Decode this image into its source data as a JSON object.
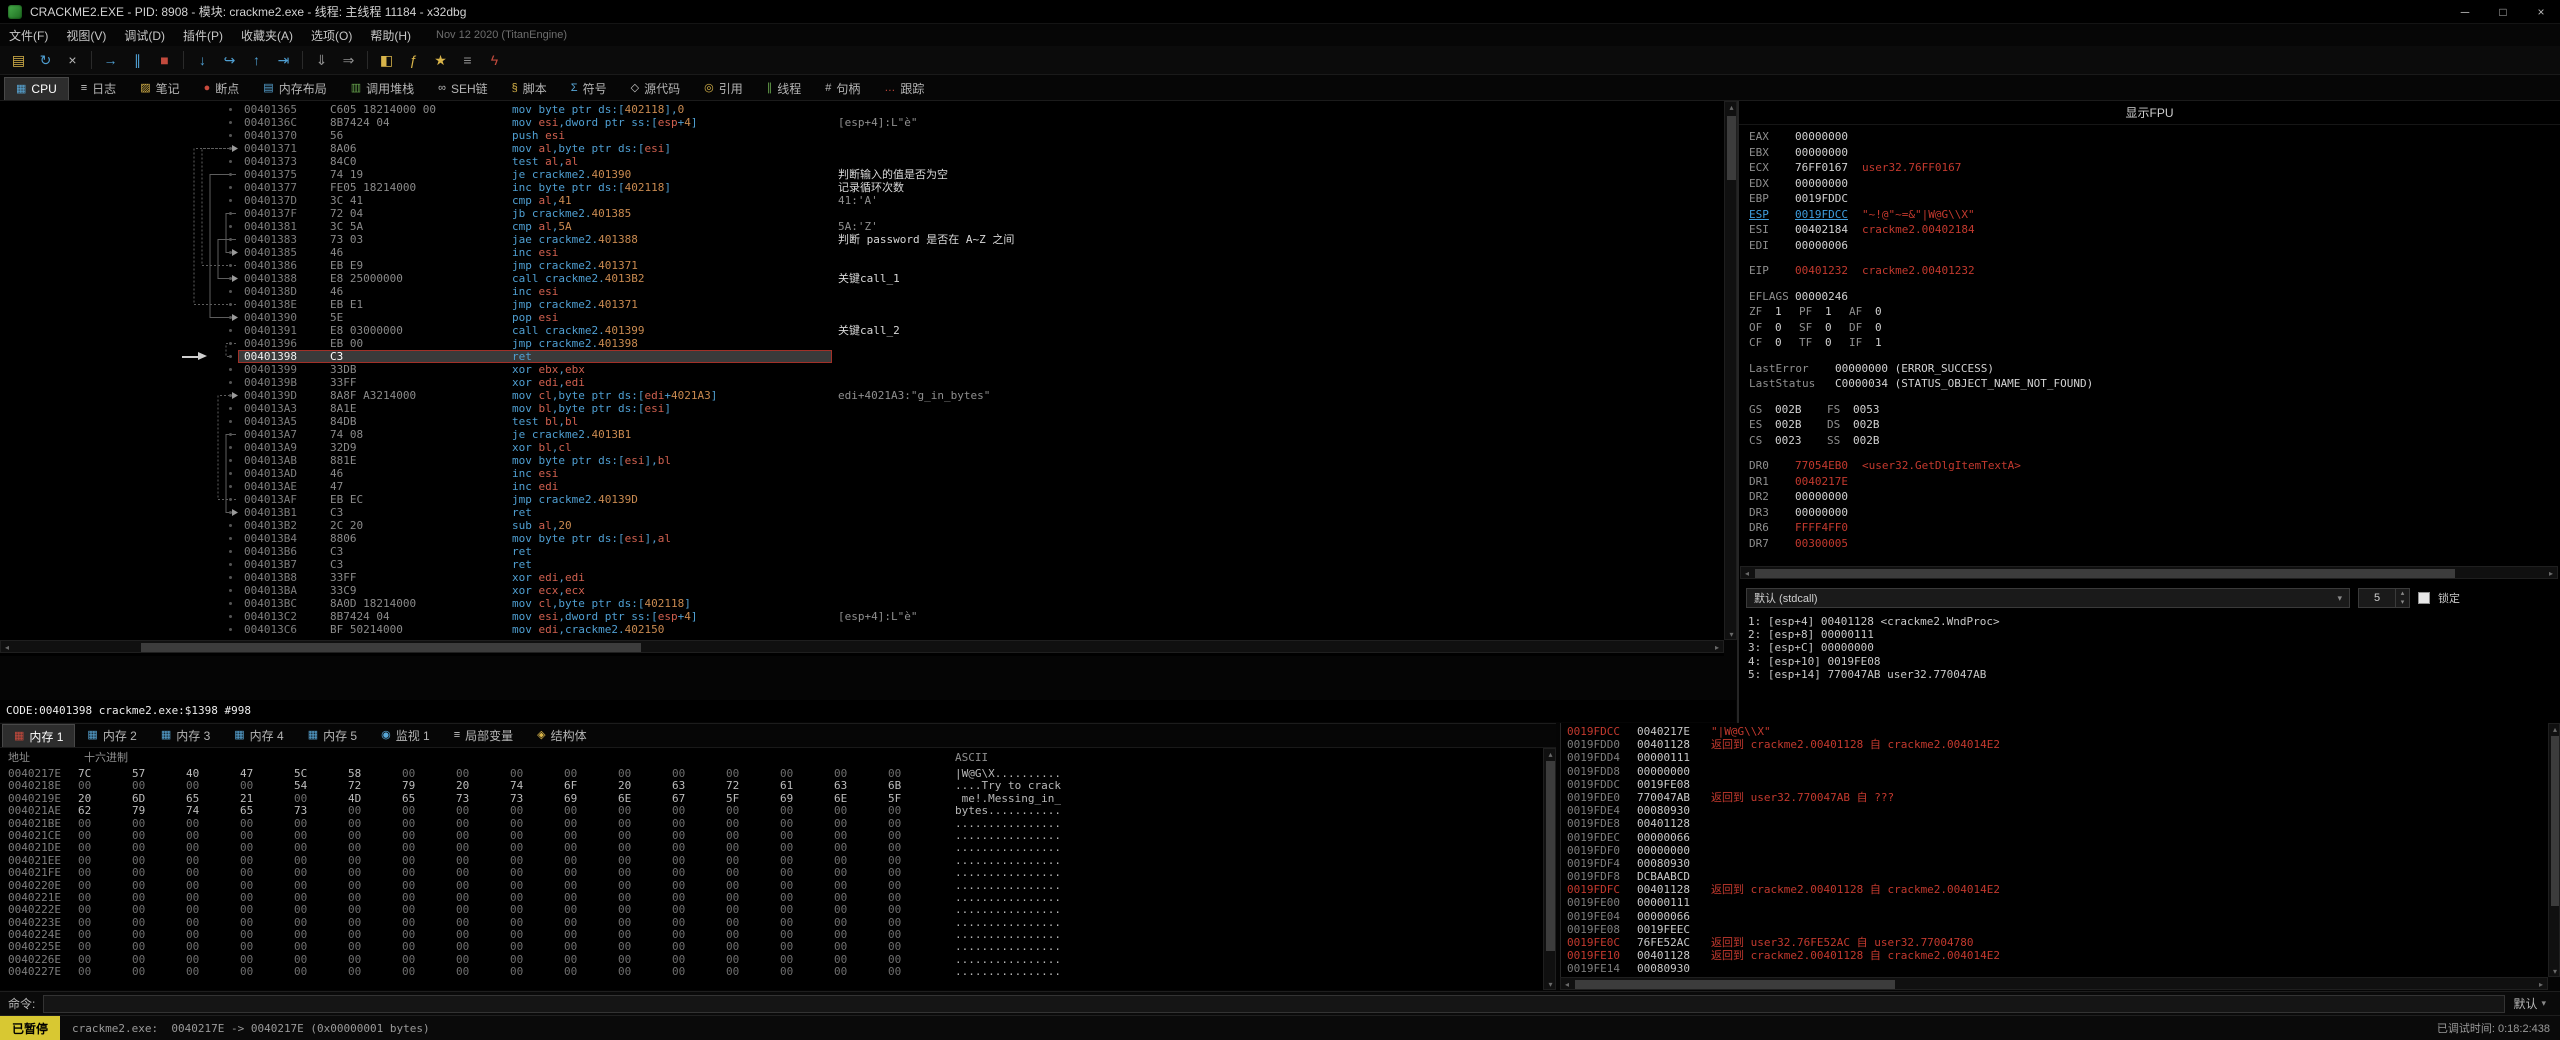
{
  "title_bar": {
    "title": "CRACKME2.EXE - PID: 8908 - 模块: crackme2.exe - 线程: 主线程 11184 - x32dbg",
    "minimize": "─",
    "maximize": "□",
    "close": "×"
  },
  "menu": {
    "items": [
      "文件(F)",
      "视图(V)",
      "调试(D)",
      "插件(P)",
      "收藏夹(A)",
      "选项(O)",
      "帮助(H)"
    ],
    "build_info": "Nov 12 2020 (TitanEngine)"
  },
  "toolbar": [
    {
      "name": "open-file",
      "glyph": "▤",
      "color": "#d8b44a"
    },
    {
      "name": "restart",
      "glyph": "↻",
      "color": "#4f9fd2"
    },
    {
      "name": "close-debuggee",
      "glyph": "×",
      "color": "#b8b8b8"
    },
    {
      "sep": true
    },
    {
      "name": "run",
      "glyph": "→",
      "color": "#4f9fd2"
    },
    {
      "name": "pause",
      "glyph": "∥",
      "color": "#4f9fd2"
    },
    {
      "name": "stop",
      "glyph": "■",
      "color": "#c24a3d"
    },
    {
      "sep": true
    },
    {
      "name": "step-into",
      "glyph": "↓",
      "color": "#4f9fd2"
    },
    {
      "name": "step-over",
      "glyph": "↪",
      "color": "#4f9fd2"
    },
    {
      "name": "step-out",
      "glyph": "↑",
      "color": "#4f9fd2"
    },
    {
      "name": "run-to-user-code",
      "glyph": "⇥",
      "color": "#4f9fd2"
    },
    {
      "sep": true
    },
    {
      "name": "trace-into",
      "glyph": "⇓",
      "color": "#8f8f8f"
    },
    {
      "name": "trace-over",
      "glyph": "⇒",
      "color": "#8f8f8f"
    },
    {
      "sep": true
    },
    {
      "name": "patch",
      "glyph": "◧",
      "color": "#d8b44a"
    },
    {
      "name": "fx-actions",
      "glyph": "ƒ",
      "color": "#d8b44a"
    },
    {
      "name": "favourites",
      "glyph": "★",
      "color": "#d8b44a"
    },
    {
      "name": "preferences",
      "glyph": "≡",
      "color": "#8f8f8f"
    },
    {
      "name": "seh-chain",
      "glyph": "ϟ",
      "color": "#c24a3d"
    }
  ],
  "view_tabs": [
    {
      "name": "cpu",
      "label": "CPU",
      "icon": "▦",
      "color": "#58a6d6",
      "active": true
    },
    {
      "name": "log",
      "label": "日志",
      "icon": "≡",
      "color": "#c8c8c8"
    },
    {
      "name": "notes",
      "label": "笔记",
      "icon": "▨",
      "color": "#d8b44a"
    },
    {
      "name": "breakpoints",
      "label": "断点",
      "icon": "●",
      "color": "#c94a3d"
    },
    {
      "name": "memory-map",
      "label": "内存布局",
      "icon": "▤",
      "color": "#58a6d6"
    },
    {
      "name": "call-stack",
      "label": "调用堆栈",
      "icon": "▥",
      "color": "#6aa84f"
    },
    {
      "name": "seh",
      "label": "SEH链",
      "icon": "∞",
      "color": "#b8b8b8"
    },
    {
      "name": "script",
      "label": "脚本",
      "icon": "§",
      "color": "#d8b44a"
    },
    {
      "name": "symbols",
      "label": "符号",
      "icon": "Σ",
      "color": "#58a6d6"
    },
    {
      "name": "source",
      "label": "源代码",
      "icon": "◇",
      "color": "#c8c8c8"
    },
    {
      "name": "references",
      "label": "引用",
      "icon": "◎",
      "color": "#d8b44a"
    },
    {
      "name": "threads",
      "label": "线程",
      "icon": "∥",
      "color": "#6aa84f"
    },
    {
      "name": "handles",
      "label": "句柄",
      "icon": "#",
      "color": "#b8b8b8"
    },
    {
      "name": "trace",
      "label": "跟踪",
      "icon": "…",
      "color": "#c94a3d"
    }
  ],
  "disasm": {
    "info_line": "CODE:00401398 crackme2.exe:$1398 #998",
    "rows": [
      {
        "a": "00401365",
        "b": "C605 18214000 00",
        "i": "mov byte ptr ds:[402118],0"
      },
      {
        "a": "0040136C",
        "b": "8B7424 04",
        "i": "mov esi,dword ptr ss:[esp+4]",
        "c": "[esp+4]:L\"è\""
      },
      {
        "a": "00401370",
        "b": "56",
        "i": "push esi"
      },
      {
        "a": "00401371",
        "b": "8A06",
        "i": "mov al,byte ptr ds:[esi]"
      },
      {
        "a": "00401373",
        "b": "84C0",
        "i": "test al,al"
      },
      {
        "a": "00401375",
        "b": "74 19",
        "i": "je crackme2.401390",
        "c": "判断输入的值是否为空",
        "u": true
      },
      {
        "a": "00401377",
        "b": "FE05 18214000",
        "i": "inc byte ptr ds:[402118]",
        "c": "记录循环次数",
        "u": true
      },
      {
        "a": "0040137D",
        "b": "3C 41",
        "i": "cmp al,41",
        "c": "41:'A'"
      },
      {
        "a": "0040137F",
        "b": "72 04",
        "i": "jb crackme2.401385"
      },
      {
        "a": "00401381",
        "b": "3C 5A",
        "i": "cmp al,5A",
        "c": "5A:'Z'"
      },
      {
        "a": "00401383",
        "b": "73 03",
        "i": "jae crackme2.401388",
        "c": "判断 password 是否在 A~Z 之间",
        "u": true
      },
      {
        "a": "00401385",
        "b": "46",
        "i": "inc esi"
      },
      {
        "a": "00401386",
        "b": "EB E9",
        "i": "jmp crackme2.401371"
      },
      {
        "a": "00401388",
        "b": "E8 25000000",
        "i": "call crackme2.4013B2",
        "c": "关键call_1",
        "u": true
      },
      {
        "a": "0040138D",
        "b": "46",
        "i": "inc esi"
      },
      {
        "a": "0040138E",
        "b": "EB E1",
        "i": "jmp crackme2.401371"
      },
      {
        "a": "00401390",
        "b": "5E",
        "i": "pop esi"
      },
      {
        "a": "00401391",
        "b": "E8 03000000",
        "i": "call crackme2.401399",
        "c": "关键call_2",
        "u": true
      },
      {
        "a": "00401396",
        "b": "EB 00",
        "i": "jmp crackme2.401398"
      },
      {
        "a": "00401398",
        "b": "C3",
        "i": "ret",
        "sel": true
      },
      {
        "a": "00401399",
        "b": "33DB",
        "i": "xor ebx,ebx"
      },
      {
        "a": "0040139B",
        "b": "33FF",
        "i": "xor edi,edi"
      },
      {
        "a": "0040139D",
        "b": "8A8F A3214000",
        "i": "mov cl,byte ptr ds:[edi+4021A3]",
        "c": "edi+4021A3:\"g_in_bytes\""
      },
      {
        "a": "004013A3",
        "b": "8A1E",
        "i": "mov bl,byte ptr ds:[esi]"
      },
      {
        "a": "004013A5",
        "b": "84DB",
        "i": "test bl,bl"
      },
      {
        "a": "004013A7",
        "b": "74 08",
        "i": "je crackme2.4013B1"
      },
      {
        "a": "004013A9",
        "b": "32D9",
        "i": "xor bl,cl"
      },
      {
        "a": "004013AB",
        "b": "881E",
        "i": "mov byte ptr ds:[esi],bl"
      },
      {
        "a": "004013AD",
        "b": "46",
        "i": "inc esi"
      },
      {
        "a": "004013AE",
        "b": "47",
        "i": "inc edi"
      },
      {
        "a": "004013AF",
        "b": "EB EC",
        "i": "jmp crackme2.40139D"
      },
      {
        "a": "004013B1",
        "b": "C3",
        "i": "ret"
      },
      {
        "a": "004013B2",
        "b": "2C 20",
        "i": "sub al,20"
      },
      {
        "a": "004013B4",
        "b": "8806",
        "i": "mov byte ptr ds:[esi],al"
      },
      {
        "a": "004013B6",
        "b": "C3",
        "i": "ret"
      },
      {
        "a": "004013B7",
        "b": "C3",
        "i": "ret"
      },
      {
        "a": "004013B8",
        "b": "33FF",
        "i": "xor edi,edi"
      },
      {
        "a": "004013BA",
        "b": "33C9",
        "i": "xor ecx,ecx"
      },
      {
        "a": "004013BC",
        "b": "8A0D 18214000",
        "i": "mov cl,byte ptr ds:[402118]"
      },
      {
        "a": "004013C2",
        "b": "8B7424 04",
        "i": "mov esi,dword ptr ss:[esp+4]",
        "c": "[esp+4]:L\"è\""
      },
      {
        "a": "004013C6",
        "b": "BF 50214000",
        "i": "mov edi,crackme2.402150"
      }
    ]
  },
  "registers": {
    "fpu_button": "显示FPU",
    "gpr": [
      {
        "name": "EAX",
        "value": "00000000"
      },
      {
        "name": "EBX",
        "value": "00000000"
      },
      {
        "name": "ECX",
        "value": "76FF0167",
        "note": "user32.76FF0167",
        "note_red": true
      },
      {
        "name": "EDX",
        "value": "00000000"
      },
      {
        "name": "EBP",
        "value": "0019FDDC"
      },
      {
        "name": "ESP",
        "value": "0019FDCC",
        "note": "\"~!@\"~=&\"|W@G\\\\X\"",
        "esp": true,
        "note_red": true
      },
      {
        "name": "ESI",
        "value": "00402184",
        "note": "crackme2.00402184",
        "note_red": true
      },
      {
        "name": "EDI",
        "value": "00000006"
      }
    ],
    "eip": {
      "name": "EIP",
      "value": "00401232",
      "note": "crackme2.00401232"
    },
    "eflags_label": "EFLAGS",
    "eflags": "00000246",
    "flag_rows": [
      [
        [
          "ZF",
          "1"
        ],
        [
          "PF",
          "1"
        ],
        [
          "AF",
          "0"
        ]
      ],
      [
        [
          "OF",
          "0"
        ],
        [
          "SF",
          "0"
        ],
        [
          "DF",
          "0"
        ]
      ],
      [
        [
          "CF",
          "0"
        ],
        [
          "TF",
          "0"
        ],
        [
          "IF",
          "1"
        ]
      ]
    ],
    "last_error_label": "LastError",
    "last_error": "00000000 (ERROR_SUCCESS)",
    "last_status_label": "LastStatus",
    "last_status": "C0000034 (STATUS_OBJECT_NAME_NOT_FOUND)",
    "seg_rows": [
      [
        [
          "GS",
          "002B"
        ],
        [
          "FS",
          "0053"
        ]
      ],
      [
        [
          "ES",
          "002B"
        ],
        [
          "DS",
          "002B"
        ]
      ],
      [
        [
          "CS",
          "0023"
        ],
        [
          "SS",
          "002B"
        ]
      ]
    ],
    "drs": [
      {
        "name": "DR0",
        "value": "77054EB0",
        "note": "<user32.GetDlgItemTextA>",
        "red": true
      },
      {
        "name": "DR1",
        "value": "0040217E",
        "red": true
      },
      {
        "name": "DR2",
        "value": "00000000"
      },
      {
        "name": "DR3",
        "value": "00000000"
      },
      {
        "name": "DR6",
        "value": "FFFF4FF0",
        "red": true
      },
      {
        "name": "DR7",
        "value": "00300005",
        "red": true
      }
    ]
  },
  "conv": {
    "selected": "默认 (stdcall)",
    "depth": "5",
    "lock_label": "锁定",
    "args": [
      "1: [esp+4] 00401128 <crackme2.WndProc>",
      "2: [esp+8] 00000111",
      "3: [esp+C] 00000000",
      "4: [esp+10] 0019FE08",
      "5: [esp+14] 770047AB user32.770047AB"
    ]
  },
  "bottom_tabs": [
    {
      "name": "memory-1",
      "label": "内存 1",
      "icon": "▦",
      "color": "#c94a3d",
      "active": true
    },
    {
      "name": "memory-2",
      "label": "内存 2",
      "icon": "▦",
      "color": "#58a6d6"
    },
    {
      "name": "memory-3",
      "label": "内存 3",
      "icon": "▦",
      "color": "#58a6d6"
    },
    {
      "name": "memory-4",
      "label": "内存 4",
      "icon": "▦",
      "color": "#58a6d6"
    },
    {
      "name": "memory-5",
      "label": "内存 5",
      "icon": "▦",
      "color": "#58a6d6"
    },
    {
      "name": "watch-1",
      "label": "监视 1",
      "icon": "◉",
      "color": "#58a6d6"
    },
    {
      "name": "locals",
      "label": "局部变量",
      "icon": "≡",
      "color": "#c8c8c8"
    },
    {
      "name": "struct",
      "label": "结构体",
      "icon": "◈",
      "color": "#d8b44a"
    }
  ],
  "dump": {
    "headers": {
      "addr": "地址",
      "hex": "十六进制",
      "ascii": "ASCII"
    },
    "rows": [
      {
        "addr": "0040217E",
        "bytes": "7C 57 40 47 5C 58 00 00 00 00 00 00 00 00 00 00",
        "ascii": "|W@G\\X.........."
      },
      {
        "addr": "0040218E",
        "bytes": "00 00 00 00 54 72 79 20 74 6F 20 63 72 61 63 6B",
        "ascii": "....Try to crack"
      },
      {
        "addr": "0040219E",
        "bytes": "20 6D 65 21 00 4D 65 73 73 69 6E 67 5F 69 6E 5F",
        "ascii": " me!.Messing_in_"
      },
      {
        "addr": "004021AE",
        "bytes": "62 79 74 65 73 00 00 00 00 00 00 00 00 00 00 00",
        "ascii": "bytes..........."
      },
      {
        "addr": "004021BE",
        "bytes": "00 00 00 00 00 00 00 00 00 00 00 00 00 00 00 00",
        "ascii": "................"
      },
      {
        "addr": "004021CE",
        "bytes": "00 00 00 00 00 00 00 00 00 00 00 00 00 00 00 00",
        "ascii": "................"
      },
      {
        "addr": "004021DE",
        "bytes": "00 00 00 00 00 00 00 00 00 00 00 00 00 00 00 00",
        "ascii": "................"
      },
      {
        "addr": "004021EE",
        "bytes": "00 00 00 00 00 00 00 00 00 00 00 00 00 00 00 00",
        "ascii": "................"
      },
      {
        "addr": "004021FE",
        "bytes": "00 00 00 00 00 00 00 00 00 00 00 00 00 00 00 00",
        "ascii": "................"
      },
      {
        "addr": "0040220E",
        "bytes": "00 00 00 00 00 00 00 00 00 00 00 00 00 00 00 00",
        "ascii": "................"
      },
      {
        "addr": "0040221E",
        "bytes": "00 00 00 00 00 00 00 00 00 00 00 00 00 00 00 00",
        "ascii": "................"
      },
      {
        "addr": "0040222E",
        "bytes": "00 00 00 00 00 00 00 00 00 00 00 00 00 00 00 00",
        "ascii": "................"
      },
      {
        "addr": "0040223E",
        "bytes": "00 00 00 00 00 00 00 00 00 00 00 00 00 00 00 00",
        "ascii": "................"
      },
      {
        "addr": "0040224E",
        "bytes": "00 00 00 00 00 00 00 00 00 00 00 00 00 00 00 00",
        "ascii": "................"
      },
      {
        "addr": "0040225E",
        "bytes": "00 00 00 00 00 00 00 00 00 00 00 00 00 00 00 00",
        "ascii": "................"
      },
      {
        "addr": "0040226E",
        "bytes": "00 00 00 00 00 00 00 00 00 00 00 00 00 00 00 00",
        "ascii": "................"
      },
      {
        "addr": "0040227E",
        "bytes": "00 00 00 00 00 00 00 00 00 00 00 00 00 00 00 00",
        "ascii": "................"
      }
    ]
  },
  "stack": {
    "rows": [
      {
        "addr": "0019FDCC",
        "value": "0040217E",
        "note": "\"|W@G\\\\X\"",
        "ared": true,
        "nred": true
      },
      {
        "addr": "0019FDD0",
        "value": "00401128",
        "note": "返回到 crackme2.00401128 自 crackme2.004014E2",
        "nred": true
      },
      {
        "addr": "0019FDD4",
        "value": "00000111"
      },
      {
        "addr": "0019FDD8",
        "value": "00000000"
      },
      {
        "addr": "0019FDDC",
        "value": "0019FE08"
      },
      {
        "addr": "0019FDE0",
        "value": "770047AB",
        "note": "返回到 user32.770047AB 自 ???",
        "nred": true
      },
      {
        "addr": "0019FDE4",
        "value": "00080930"
      },
      {
        "addr": "0019FDE8",
        "value": "00401128"
      },
      {
        "addr": "0019FDEC",
        "value": "00000066"
      },
      {
        "addr": "0019FDF0",
        "value": "00000000"
      },
      {
        "addr": "0019FDF4",
        "value": "00080930"
      },
      {
        "addr": "0019FDF8",
        "value": "DCBAABCD"
      },
      {
        "addr": "0019FDFC",
        "value": "00401128",
        "note": "返回到 crackme2.00401128 自 crackme2.004014E2",
        "ared": true,
        "nred": true
      },
      {
        "addr": "0019FE00",
        "value": "00000111"
      },
      {
        "addr": "0019FE04",
        "value": "00000066"
      },
      {
        "addr": "0019FE08",
        "value": "0019FEEC"
      },
      {
        "addr": "0019FE0C",
        "value": "76FE52AC",
        "note": "返回到 user32.76FE52AC 自 user32.77004780",
        "ared": true,
        "nred": true
      },
      {
        "addr": "0019FE10",
        "value": "00401128",
        "note": "返回到 crackme2.00401128 自 crackme2.004014E2",
        "ared": true,
        "nred": true
      },
      {
        "addr": "0019FE14",
        "value": "00080930"
      }
    ]
  },
  "command": {
    "label": "命令:",
    "profile": "默认"
  },
  "status": {
    "state": "已暂停",
    "log": "crackme2.exe:  0040217E -> 0040217E (0x00000001 bytes)",
    "time": "已调试时间: 0:18:2:438"
  },
  "icons": {
    "combo_arrow": "▾",
    "spin_up": "▴",
    "spin_down": "▾",
    "scroll_left": "◂",
    "scroll_right": "▸",
    "scroll_up": "▴",
    "scroll_down": "▾"
  }
}
